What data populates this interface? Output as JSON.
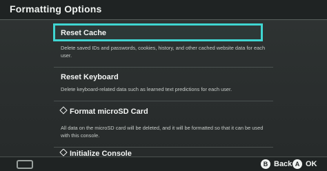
{
  "header": {
    "title": "Formatting Options"
  },
  "items": [
    {
      "title": "Reset Cache",
      "description": "Delete saved IDs and passwords, cookies, history, and other cached website data for each user."
    },
    {
      "title": "Reset Keyboard",
      "description": "Delete keyboard-related data such as learned text predictions for each user."
    },
    {
      "title": "Format microSD Card",
      "description": "All data on the microSD card will be deleted, and it will be formatted so that it can be used with this console."
    },
    {
      "title": "Initialize Console",
      "description": ""
    }
  ],
  "footer": {
    "back_key": "B",
    "back_label": "Back",
    "ok_key": "A",
    "ok_label": "OK"
  },
  "colors": {
    "selection": "#3fd6d2",
    "background": "#2b2f2f"
  }
}
